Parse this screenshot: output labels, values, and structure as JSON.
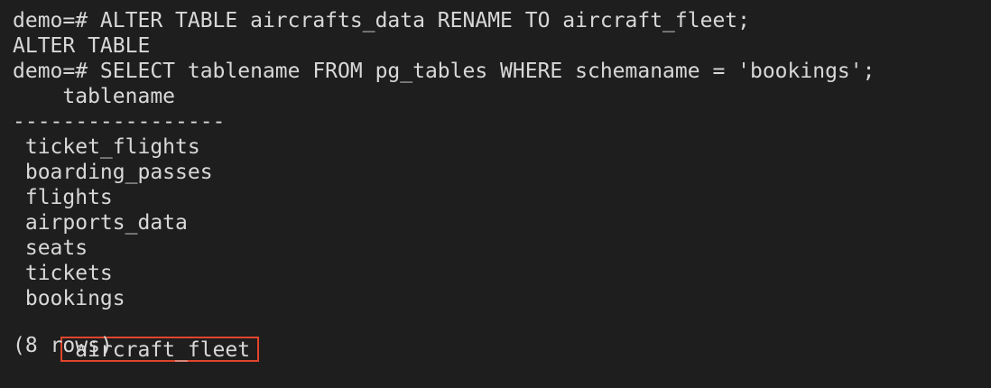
{
  "terminal": {
    "lines": [
      "demo=# ALTER TABLE aircrafts_data RENAME TO aircraft_fleet;",
      "ALTER TABLE",
      "demo=# SELECT tablename FROM pg_tables WHERE schemaname = 'bookings';",
      "    tablename",
      "-----------------",
      " ticket_flights",
      " boarding_passes",
      " flights",
      " airports_data",
      " seats",
      " tickets",
      " bookings"
    ],
    "highlighted_row": " aircraft_fleet",
    "row_count": "(8 rows)",
    "highlight_color": "#e0452b",
    "background_color": "#1e1e1e",
    "text_color": "#d8d8d8"
  }
}
